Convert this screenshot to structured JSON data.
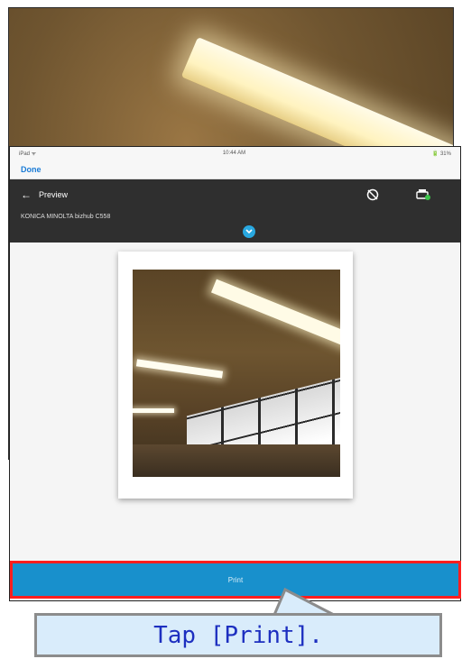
{
  "ipad": {
    "status_left": "iPad ᯤ",
    "status_time": "10:44 AM",
    "status_battery": "🔋 31%",
    "done_label": "Done",
    "toolbar": {
      "title": "Preview",
      "printer_name": "KONICA MINOLTA bizhub C558"
    },
    "print_button_label": "Print"
  },
  "instruction": "Tap [Print].",
  "colors": {
    "toolbar_bg": "#2f2f2f",
    "accent_blue": "#1890cc",
    "highlight_red": "#ff1e1e",
    "callout_bg": "#d9ecfb",
    "callout_text": "#1d2fc0"
  }
}
